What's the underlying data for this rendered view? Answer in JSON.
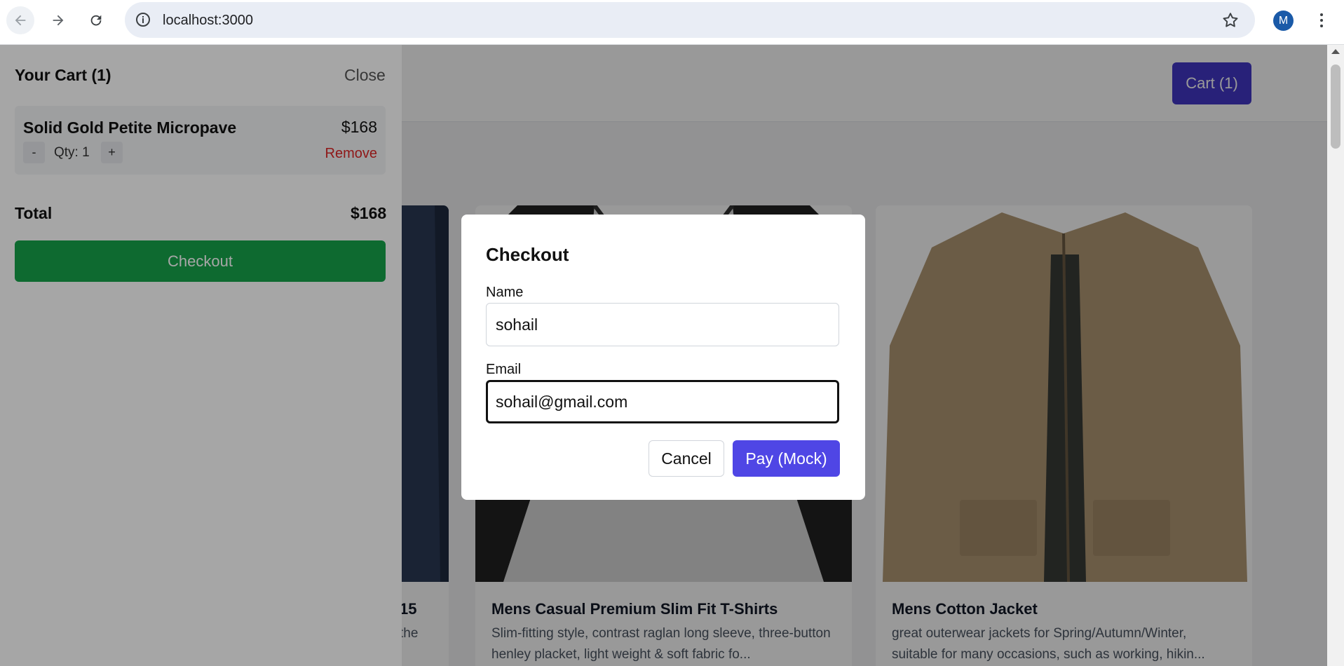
{
  "browser": {
    "url": "localhost:3000",
    "profile_initial": "M",
    "icons": {
      "back": "arrow-left-icon",
      "forward": "arrow-right-icon",
      "reload": "reload-icon",
      "info": "info-icon",
      "bookmark": "star-icon",
      "menu": "kebab-menu-icon"
    }
  },
  "header": {
    "cart_button": "Cart (1)"
  },
  "products": [
    {
      "title": "15",
      "desc": "the"
    },
    {
      "title": "Mens Casual Premium Slim Fit T-Shirts",
      "desc": "Slim-fitting style, contrast raglan long sleeve, three-button henley placket, light weight & soft fabric fo..."
    },
    {
      "title": "Mens Cotton Jacket",
      "desc": "great outerwear jackets for Spring/Autumn/Winter, suitable for many occasions, such as working, hikin..."
    }
  ],
  "cart": {
    "title": "Your Cart (1)",
    "close_label": "Close",
    "items": [
      {
        "name": "Solid Gold Petite Micropave",
        "price": "$168",
        "qty_label": "Qty: 1",
        "minus": "-",
        "plus": "+",
        "remove": "Remove"
      }
    ],
    "total_label": "Total",
    "total_value": "$168",
    "checkout_label": "Checkout"
  },
  "checkout_modal": {
    "title": "Checkout",
    "name_label": "Name",
    "name_value": "sohail",
    "email_label": "Email",
    "email_value": "sohail@gmail.com",
    "cancel_label": "Cancel",
    "pay_label": "Pay (Mock)"
  },
  "colors": {
    "accent": "#4338ca",
    "pay": "#4f46e5",
    "checkout": "#16a34a",
    "remove": "#dc2626"
  }
}
